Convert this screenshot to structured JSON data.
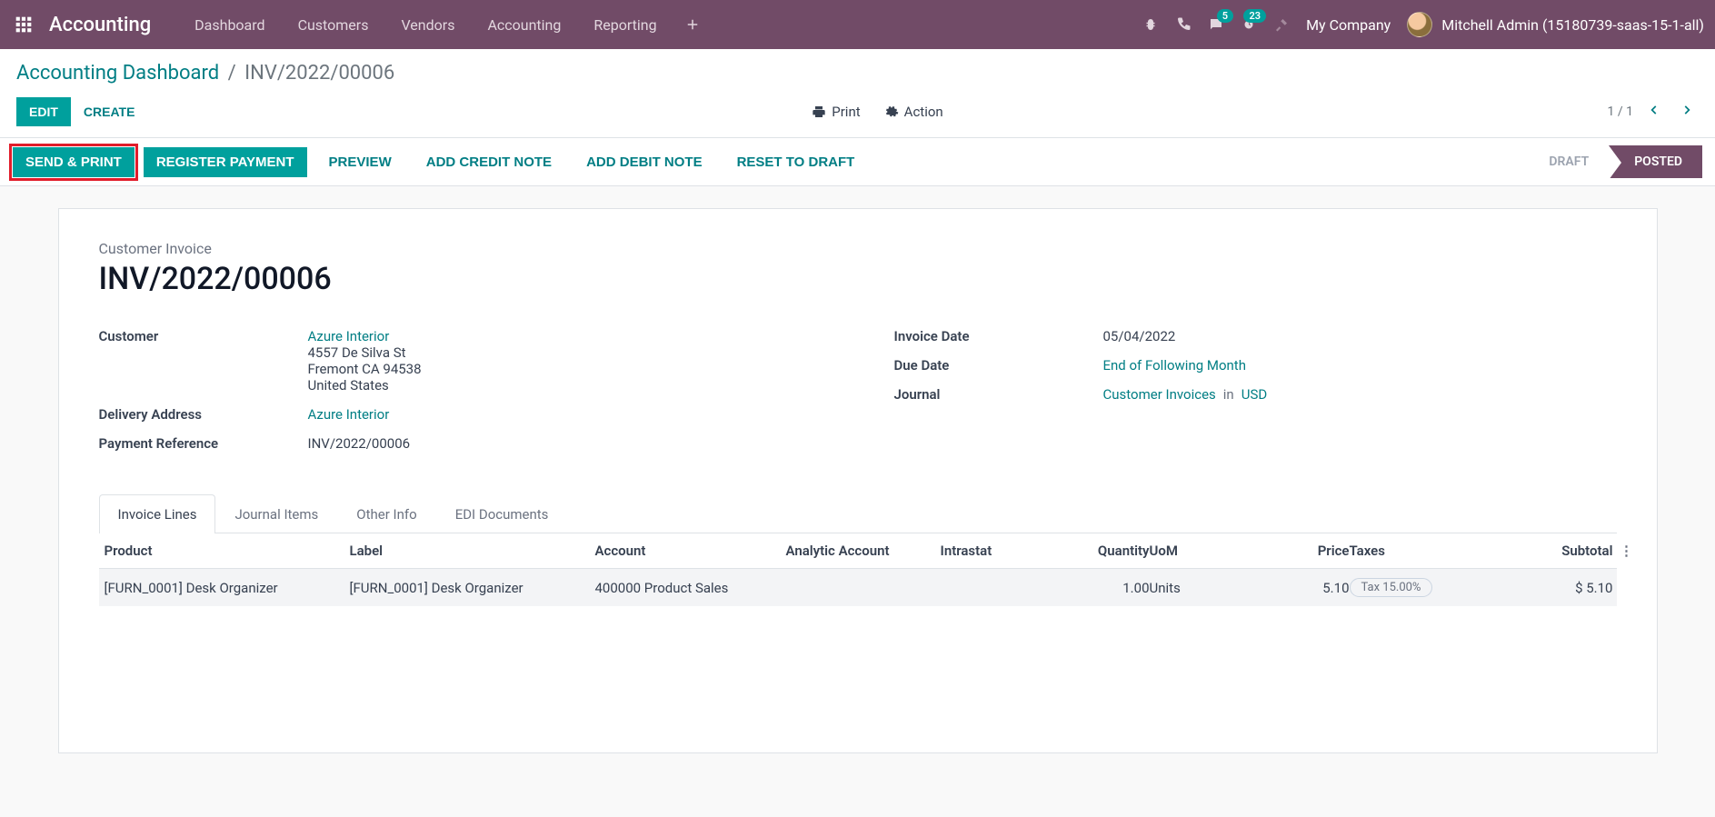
{
  "navbar": {
    "brand": "Accounting",
    "links": [
      "Dashboard",
      "Customers",
      "Vendors",
      "Accounting",
      "Reporting"
    ],
    "msg_badge": "5",
    "activity_badge": "23",
    "company": "My Company",
    "user": "Mitchell Admin (15180739-saas-15-1-all)"
  },
  "breadcrumb": {
    "root": "Accounting Dashboard",
    "current": "INV/2022/00006"
  },
  "controls": {
    "edit": "EDIT",
    "create": "CREATE",
    "print": "Print",
    "action": "Action",
    "pager": "1 / 1"
  },
  "actions": {
    "send_print": "SEND & PRINT",
    "register_payment": "REGISTER PAYMENT",
    "preview": "PREVIEW",
    "add_credit": "ADD CREDIT NOTE",
    "add_debit": "ADD DEBIT NOTE",
    "reset": "RESET TO DRAFT",
    "draft": "DRAFT",
    "posted": "POSTED"
  },
  "form": {
    "subtitle": "Customer Invoice",
    "title": "INV/2022/00006",
    "customer_label": "Customer",
    "customer_name": "Azure Interior",
    "customer_addr1": "4557 De Silva St",
    "customer_addr2": "Fremont CA 94538",
    "customer_addr3": "United States",
    "delivery_label": "Delivery Address",
    "delivery_value": "Azure Interior",
    "payref_label": "Payment Reference",
    "payref_value": "INV/2022/00006",
    "invdate_label": "Invoice Date",
    "invdate_value": "05/04/2022",
    "duedate_label": "Due Date",
    "duedate_value": "End of Following Month",
    "journal_label": "Journal",
    "journal_value": "Customer Invoices",
    "journal_in": "in",
    "journal_currency": "USD"
  },
  "tabs": [
    "Invoice Lines",
    "Journal Items",
    "Other Info",
    "EDI Documents"
  ],
  "grid": {
    "headers": {
      "product": "Product",
      "label": "Label",
      "account": "Account",
      "analytic": "Analytic Account",
      "intrastat": "Intrastat",
      "qty": "Quantity",
      "uom": "UoM",
      "price": "Price",
      "taxes": "Taxes",
      "subtotal": "Subtotal"
    },
    "row": {
      "product": "[FURN_0001] Desk Organizer",
      "label": "[FURN_0001] Desk Organizer",
      "account": "400000 Product Sales",
      "analytic": "",
      "intrastat": "",
      "qty": "1.00",
      "uom": "Units",
      "price": "5.10",
      "tax": "Tax 15.00%",
      "subtotal": "$ 5.10"
    }
  }
}
